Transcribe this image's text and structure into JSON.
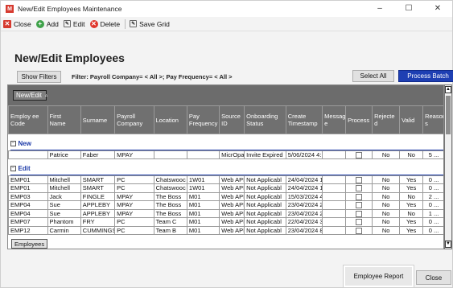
{
  "window": {
    "app_icon_letter": "M",
    "title": "New/Edit Employees Maintenance",
    "min_glyph": "–",
    "max_glyph": "☐",
    "close_glyph": "✕"
  },
  "toolbar": {
    "close_label": "Close",
    "add_label": "Add",
    "edit_label": "Edit",
    "delete_label": "Delete",
    "save_grid_label": "Save Grid",
    "close_icon_glyph": "✕",
    "add_icon_glyph": "+",
    "edit_icon_glyph": "✎",
    "delete_icon_glyph": "✕",
    "save_icon_glyph": "✎"
  },
  "page_title": "New/Edit Employees",
  "filters": {
    "show_filters_label": "Show Filters",
    "filter_text": "Filter: Payroll Company= < All >; Pay Frequency= < All >",
    "select_all_label": "Select All",
    "process_batch_label": "Process Batch"
  },
  "grid": {
    "group_chip": "New/Edit",
    "group_chip_arrow": "▵",
    "columns": [
      "Employ ee Code",
      "First Name",
      "Surname",
      "Payroll Company",
      "Location",
      "Pay Frequency",
      "Source ID",
      "Onboarding Status",
      "Create Timestamp",
      "Messag e",
      "Process",
      "Rejecte d",
      "Valid",
      "Reason s"
    ],
    "groups": [
      {
        "label": "New",
        "expander": "−",
        "rows": [
          [
            "",
            "Patrice",
            "Faber",
            "MPAY",
            "",
            "",
            "MicrOpa",
            "Invite Expired",
            "5/06/2024 4:",
            "",
            "chk",
            "No",
            "No",
            "5 ..."
          ]
        ]
      },
      {
        "label": "Edit",
        "expander": "−",
        "rows": [
          [
            "EMP01",
            "Mitchell",
            "SMART",
            "PC",
            "Chatswooc",
            "1W01",
            "Web API",
            "Not Applicabl",
            "24/04/2024 1",
            "",
            "chk",
            "No",
            "Yes",
            "0 ..."
          ],
          [
            "EMP01",
            "Mitchell",
            "SMART",
            "PC",
            "Chatswooc",
            "1W01",
            "Web API",
            "Not Applicabl",
            "24/04/2024 1",
            "",
            "chk",
            "No",
            "Yes",
            "0 ..."
          ],
          [
            "EMP03",
            "Jack",
            "FINGLE",
            "MPAY",
            "The Boss",
            "M01",
            "Web API",
            "Not Applicabl",
            "15/03/2024 4",
            "",
            "chk",
            "No",
            "No",
            "2 ..."
          ],
          [
            "EMP04",
            "Sue",
            "APPLEBY",
            "MPAY",
            "The Boss",
            "M01",
            "Web API",
            "Not Applicabl",
            "23/04/2024 2",
            "",
            "chk",
            "No",
            "Yes",
            "0 ..."
          ],
          [
            "EMP04",
            "Sue",
            "APPLEBY",
            "MPAY",
            "The Boss",
            "M01",
            "Web API",
            "Not Applicabl",
            "23/04/2024 2",
            "",
            "chk",
            "No",
            "No",
            "1 ..."
          ],
          [
            "EMP07",
            "Phantom",
            "FRY",
            "PC",
            "Team C",
            "M01",
            "Web API",
            "Not Applicabl",
            "22/04/2024 3",
            "",
            "chk",
            "No",
            "Yes",
            "0 ..."
          ],
          [
            "EMP12",
            "Carmin",
            "CUMMINGS",
            "PC",
            "Team B",
            "M01",
            "Web API",
            "Not Applicabl",
            "23/04/2024 8",
            "",
            "chk",
            "No",
            "Yes",
            "0 ..."
          ]
        ]
      }
    ],
    "tab_label": "Employees",
    "scroll_up_glyph": "▲",
    "scroll_down_glyph": "▼"
  },
  "footer": {
    "employee_report_label": "Employee Report",
    "close_label": "Close"
  },
  "colors": {
    "process_batch_bg": "#1e3fb3",
    "group_band_text": "#1c3aa8",
    "header_bg": "#707070",
    "app_icon": "#d63a2f"
  }
}
